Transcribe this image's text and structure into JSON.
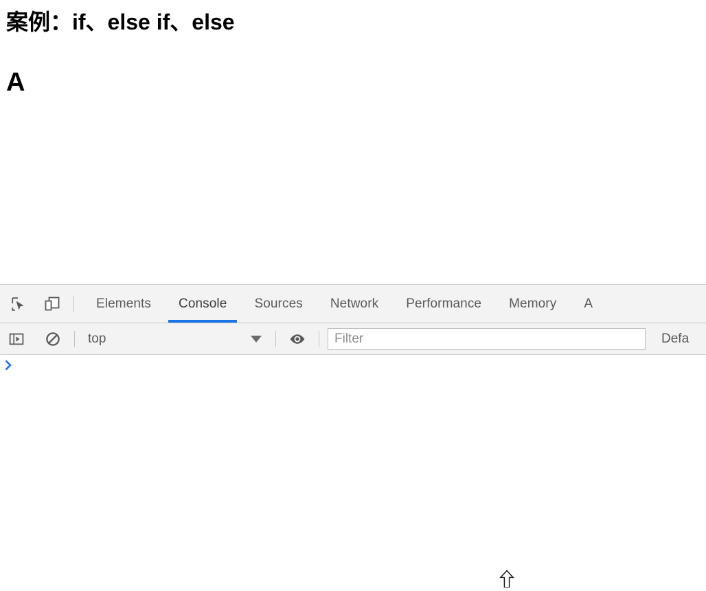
{
  "page": {
    "heading": "案例：if、else if、else",
    "output": "A"
  },
  "devtools": {
    "toolbar_icons": [
      {
        "name": "inspect-element-icon",
        "title": "Inspect element"
      },
      {
        "name": "device-toolbar-icon",
        "title": "Toggle device toolbar"
      }
    ],
    "tabs": [
      {
        "label": "Elements",
        "selected": false
      },
      {
        "label": "Console",
        "selected": true
      },
      {
        "label": "Sources",
        "selected": false
      },
      {
        "label": "Network",
        "selected": false
      },
      {
        "label": "Performance",
        "selected": false
      },
      {
        "label": "Memory",
        "selected": false
      },
      {
        "label": "A",
        "selected": false
      }
    ],
    "active_tab": "Console",
    "accent_color": "#1a73e8",
    "console_toolbar": {
      "sidebar_toggle_icon": "console-sidebar-icon",
      "clear_console_icon": "clear-console-icon",
      "context": "top",
      "context_caret_icon": "chevron-down-icon",
      "eye_icon": "eye-icon",
      "filter_value": "",
      "filter_placeholder": "Filter",
      "levels_label": "Defa"
    },
    "console": {
      "prompt_symbol": "›",
      "prompt_color": "#1a73e8",
      "input_value": ""
    }
  },
  "cursor": {
    "icon": "up-arrow-outline-icon"
  }
}
